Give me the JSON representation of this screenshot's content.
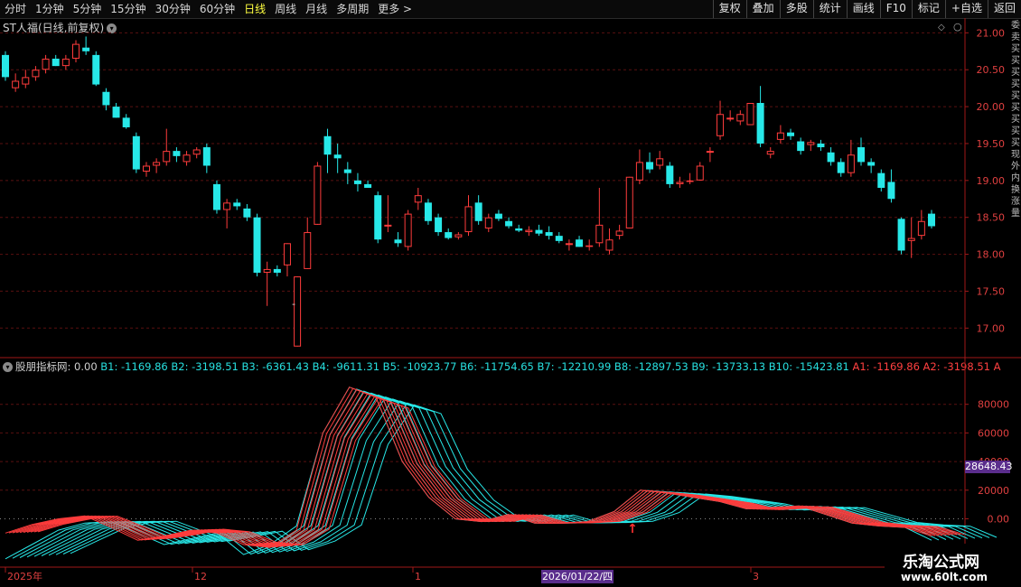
{
  "toolbar": {
    "tabs": [
      "分时",
      "1分钟",
      "5分钟",
      "15分钟",
      "30分钟",
      "60分钟",
      "日线",
      "周线",
      "月线",
      "多周期",
      "更多 >"
    ],
    "active_tab": "日线",
    "right_buttons": [
      "复权",
      "叠加",
      "多股",
      "统计",
      "画线",
      "F10",
      "标记",
      "+自选",
      "返回"
    ]
  },
  "main_chart": {
    "title": "ST人福(日线,前复权)",
    "y_ticks": [
      "21.00",
      "20.50",
      "20.00",
      "19.50",
      "19.00",
      "18.50",
      "18.00",
      "17.50",
      "17.00"
    ],
    "stray_marker": "-"
  },
  "indicator": {
    "name": "股朋指标网",
    "value": ": 0.00",
    "b_labels": "B1: -1169.86  B2: -3198.51  B3: -6361.43  B4: -9611.31  B5: -10923.77  B6: -11754.65  B7: -12210.99  B8: -12897.53  B9: -13733.13  B10: -15423.81",
    "a_labels": "A1: -1169.86  A2: -3198.51  A",
    "y_ticks": [
      "80000",
      "60000",
      "40000",
      "20000",
      "0.00"
    ],
    "current_value": "28648.43"
  },
  "x_axis": {
    "labels": [
      "2025年",
      "12",
      "1",
      "3"
    ],
    "cursor_date": "2026/01/22/四"
  },
  "right_side_text": "委卖买买买买买买买买买现外内换涨量",
  "watermark": {
    "line1": "乐淘公式网",
    "line2": "www.60lt.com"
  },
  "colors": {
    "up": "#ff3c3c",
    "down": "#27e8e8",
    "grid": "#5a1010",
    "axis": "#a01818",
    "active_tab": "#ffff40",
    "badge": "#5a2d8c"
  },
  "chart_data": {
    "type": "candlestick",
    "title": "ST人福(日线,前复权)",
    "ylim": [
      16.6,
      21.2
    ],
    "candles": [
      {
        "o": 20.7,
        "h": 20.75,
        "l": 20.35,
        "c": 20.4
      },
      {
        "o": 20.25,
        "h": 20.45,
        "l": 20.2,
        "c": 20.35
      },
      {
        "o": 20.3,
        "h": 20.5,
        "l": 20.25,
        "c": 20.4
      },
      {
        "o": 20.4,
        "h": 20.55,
        "l": 20.35,
        "c": 20.5
      },
      {
        "o": 20.5,
        "h": 20.7,
        "l": 20.45,
        "c": 20.65
      },
      {
        "o": 20.65,
        "h": 20.7,
        "l": 20.55,
        "c": 20.55
      },
      {
        "o": 20.55,
        "h": 20.7,
        "l": 20.5,
        "c": 20.65
      },
      {
        "o": 20.65,
        "h": 20.9,
        "l": 20.6,
        "c": 20.85
      },
      {
        "o": 20.8,
        "h": 20.95,
        "l": 20.7,
        "c": 20.75
      },
      {
        "o": 20.7,
        "h": 20.75,
        "l": 20.28,
        "c": 20.3
      },
      {
        "o": 20.2,
        "h": 20.25,
        "l": 19.95,
        "c": 20.02
      },
      {
        "o": 20.0,
        "h": 20.05,
        "l": 19.85,
        "c": 19.85
      },
      {
        "o": 19.85,
        "h": 19.9,
        "l": 19.7,
        "c": 19.72
      },
      {
        "o": 19.6,
        "h": 19.65,
        "l": 19.1,
        "c": 19.15
      },
      {
        "o": 19.12,
        "h": 19.25,
        "l": 19.05,
        "c": 19.2
      },
      {
        "o": 19.2,
        "h": 19.3,
        "l": 19.1,
        "c": 19.25
      },
      {
        "o": 19.25,
        "h": 19.7,
        "l": 19.2,
        "c": 19.4
      },
      {
        "o": 19.4,
        "h": 19.45,
        "l": 19.25,
        "c": 19.33
      },
      {
        "o": 19.25,
        "h": 19.4,
        "l": 19.2,
        "c": 19.35
      },
      {
        "o": 19.35,
        "h": 19.45,
        "l": 19.3,
        "c": 19.42
      },
      {
        "o": 19.45,
        "h": 19.5,
        "l": 19.1,
        "c": 19.2
      },
      {
        "o": 18.95,
        "h": 19.0,
        "l": 18.55,
        "c": 18.6
      },
      {
        "o": 18.6,
        "h": 18.75,
        "l": 18.35,
        "c": 18.7
      },
      {
        "o": 18.7,
        "h": 18.75,
        "l": 18.6,
        "c": 18.65
      },
      {
        "o": 18.62,
        "h": 18.68,
        "l": 18.45,
        "c": 18.5
      },
      {
        "o": 18.5,
        "h": 18.55,
        "l": 17.7,
        "c": 17.75
      },
      {
        "o": 17.75,
        "h": 17.9,
        "l": 17.3,
        "c": 17.8
      },
      {
        "o": 17.8,
        "h": 17.85,
        "l": 17.7,
        "c": 17.75
      },
      {
        "o": 17.85,
        "h": 18.15,
        "l": 17.7,
        "c": 18.15
      },
      {
        "o": 16.75,
        "h": 17.7,
        "l": 16.75,
        "c": 17.7
      },
      {
        "o": 17.8,
        "h": 18.5,
        "l": 17.8,
        "c": 18.3
      },
      {
        "o": 18.4,
        "h": 19.25,
        "l": 18.4,
        "c": 19.2
      },
      {
        "o": 19.6,
        "h": 19.7,
        "l": 19.1,
        "c": 19.35
      },
      {
        "o": 19.35,
        "h": 19.5,
        "l": 19.1,
        "c": 19.3
      },
      {
        "o": 19.15,
        "h": 19.25,
        "l": 18.95,
        "c": 19.1
      },
      {
        "o": 19.0,
        "h": 19.1,
        "l": 18.85,
        "c": 18.95
      },
      {
        "o": 18.95,
        "h": 19.0,
        "l": 18.9,
        "c": 18.9
      },
      {
        "o": 18.8,
        "h": 18.85,
        "l": 18.15,
        "c": 18.2
      },
      {
        "o": 18.4,
        "h": 18.8,
        "l": 18.3,
        "c": 18.4
      },
      {
        "o": 18.2,
        "h": 18.3,
        "l": 18.1,
        "c": 18.15
      },
      {
        "o": 18.1,
        "h": 18.6,
        "l": 18.05,
        "c": 18.55
      },
      {
        "o": 18.7,
        "h": 18.9,
        "l": 18.6,
        "c": 18.8
      },
      {
        "o": 18.7,
        "h": 18.75,
        "l": 18.4,
        "c": 18.45
      },
      {
        "o": 18.5,
        "h": 18.55,
        "l": 18.25,
        "c": 18.3
      },
      {
        "o": 18.3,
        "h": 18.35,
        "l": 18.2,
        "c": 18.22
      },
      {
        "o": 18.23,
        "h": 18.3,
        "l": 18.2,
        "c": 18.27
      },
      {
        "o": 18.3,
        "h": 18.8,
        "l": 18.25,
        "c": 18.65
      },
      {
        "o": 18.7,
        "h": 18.8,
        "l": 18.4,
        "c": 18.45
      },
      {
        "o": 18.35,
        "h": 18.55,
        "l": 18.3,
        "c": 18.5
      },
      {
        "o": 18.55,
        "h": 18.6,
        "l": 18.45,
        "c": 18.48
      },
      {
        "o": 18.45,
        "h": 18.5,
        "l": 18.35,
        "c": 18.38
      },
      {
        "o": 18.35,
        "h": 18.4,
        "l": 18.3,
        "c": 18.32
      },
      {
        "o": 18.3,
        "h": 18.38,
        "l": 18.25,
        "c": 18.33
      },
      {
        "o": 18.33,
        "h": 18.4,
        "l": 18.25,
        "c": 18.28
      },
      {
        "o": 18.3,
        "h": 18.38,
        "l": 18.2,
        "c": 18.25
      },
      {
        "o": 18.25,
        "h": 18.3,
        "l": 18.15,
        "c": 18.18
      },
      {
        "o": 18.15,
        "h": 18.2,
        "l": 18.05,
        "c": 18.15
      },
      {
        "o": 18.2,
        "h": 18.25,
        "l": 18.1,
        "c": 18.1
      },
      {
        "o": 18.1,
        "h": 18.2,
        "l": 18.05,
        "c": 18.12
      },
      {
        "o": 18.15,
        "h": 18.9,
        "l": 18.1,
        "c": 18.4
      },
      {
        "o": 18.05,
        "h": 18.35,
        "l": 18.0,
        "c": 18.2
      },
      {
        "o": 18.25,
        "h": 18.4,
        "l": 18.2,
        "c": 18.32
      },
      {
        "o": 18.35,
        "h": 19.05,
        "l": 18.35,
        "c": 19.05
      },
      {
        "o": 19.0,
        "h": 19.42,
        "l": 18.95,
        "c": 19.25
      },
      {
        "o": 19.25,
        "h": 19.38,
        "l": 19.1,
        "c": 19.15
      },
      {
        "o": 19.2,
        "h": 19.4,
        "l": 19.15,
        "c": 19.3
      },
      {
        "o": 19.2,
        "h": 19.25,
        "l": 18.9,
        "c": 18.95
      },
      {
        "o": 18.95,
        "h": 19.05,
        "l": 18.9,
        "c": 18.98
      },
      {
        "o": 18.98,
        "h": 19.1,
        "l": 18.95,
        "c": 19.0
      },
      {
        "o": 19.0,
        "h": 19.25,
        "l": 19.0,
        "c": 19.2
      },
      {
        "o": 19.4,
        "h": 19.45,
        "l": 19.25,
        "c": 19.4
      },
      {
        "o": 19.6,
        "h": 20.08,
        "l": 19.55,
        "c": 19.9
      },
      {
        "o": 19.85,
        "h": 19.95,
        "l": 19.8,
        "c": 19.85
      },
      {
        "o": 19.8,
        "h": 19.95,
        "l": 19.75,
        "c": 19.9
      },
      {
        "o": 19.75,
        "h": 20.05,
        "l": 19.75,
        "c": 20.05
      },
      {
        "o": 20.05,
        "h": 20.28,
        "l": 19.45,
        "c": 19.5
      },
      {
        "o": 19.35,
        "h": 19.45,
        "l": 19.3,
        "c": 19.4
      },
      {
        "o": 19.55,
        "h": 19.75,
        "l": 19.5,
        "c": 19.65
      },
      {
        "o": 19.65,
        "h": 19.7,
        "l": 19.55,
        "c": 19.6
      },
      {
        "o": 19.53,
        "h": 19.58,
        "l": 19.35,
        "c": 19.4
      },
      {
        "o": 19.48,
        "h": 19.55,
        "l": 19.4,
        "c": 19.52
      },
      {
        "o": 19.5,
        "h": 19.55,
        "l": 19.4,
        "c": 19.45
      },
      {
        "o": 19.38,
        "h": 19.45,
        "l": 19.2,
        "c": 19.25
      },
      {
        "o": 19.25,
        "h": 19.3,
        "l": 19.05,
        "c": 19.1
      },
      {
        "o": 19.1,
        "h": 19.55,
        "l": 19.05,
        "c": 19.35
      },
      {
        "o": 19.45,
        "h": 19.58,
        "l": 19.2,
        "c": 19.25
      },
      {
        "o": 19.25,
        "h": 19.3,
        "l": 19.1,
        "c": 19.2
      },
      {
        "o": 19.1,
        "h": 19.15,
        "l": 18.85,
        "c": 18.9
      },
      {
        "o": 18.98,
        "h": 19.15,
        "l": 18.7,
        "c": 18.75
      },
      {
        "o": 18.48,
        "h": 18.5,
        "l": 18.0,
        "c": 18.05
      },
      {
        "o": 18.18,
        "h": 18.5,
        "l": 17.95,
        "c": 18.22
      },
      {
        "o": 18.25,
        "h": 18.6,
        "l": 18.2,
        "c": 18.45
      },
      {
        "o": 18.55,
        "h": 18.6,
        "l": 18.35,
        "c": 18.38
      }
    ],
    "indicator_series": [
      {
        "color": "red",
        "values": [
          -10000,
          -4000,
          0,
          2000,
          -6000,
          -15000,
          -12000,
          -8000,
          -10000,
          -18000,
          -20000,
          -8000,
          60000,
          92000,
          85000,
          40000,
          15000,
          0,
          -2000,
          3000,
          -3000,
          -3000,
          -2000,
          5000,
          20000,
          18000,
          15000,
          12000,
          7000,
          8000,
          9000,
          3000,
          -3000,
          -5000,
          -6000,
          -12000
        ]
      },
      {
        "color": "cyan",
        "values": [
          -28000,
          -18000,
          -8000,
          -3000,
          -2000,
          -10000,
          -18000,
          -14000,
          -10000,
          -25000,
          -18000,
          -5000,
          60000,
          92000,
          85000,
          40000,
          15000,
          0,
          -2000,
          3000,
          -3000,
          -3000,
          -2000,
          5000,
          20000,
          18000,
          15000,
          12000,
          7000,
          8000,
          9000,
          3000,
          -3000,
          -5000,
          -6000,
          -15000
        ]
      }
    ]
  }
}
